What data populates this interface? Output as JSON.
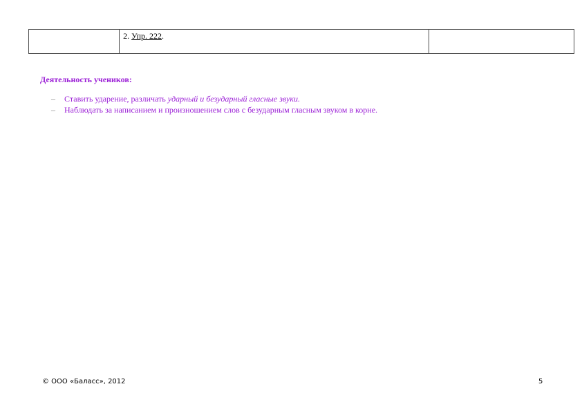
{
  "table": {
    "row": {
      "cell_left": "",
      "cell_middle": {
        "prefix": "2. ",
        "link": "Упр. 222",
        "suffix": "."
      },
      "cell_right": ""
    }
  },
  "activities": {
    "title": "Деятельность учеников:",
    "items": [
      {
        "bullet": "–",
        "text_plain": "Ставить ударение, различать ",
        "text_italic": "ударный и безударный гласные звуки."
      },
      {
        "bullet": "–",
        "text_plain": "Наблюдать за написанием и произношением слов с безударным гласным звуком в корне.",
        "text_italic": ""
      }
    ]
  },
  "footer": {
    "copyright": "© ООО «Баласс», 2012",
    "page_number": "5"
  },
  "colors": {
    "accent_text": "#9b1fd6",
    "table_border": "#4a4a4a"
  }
}
